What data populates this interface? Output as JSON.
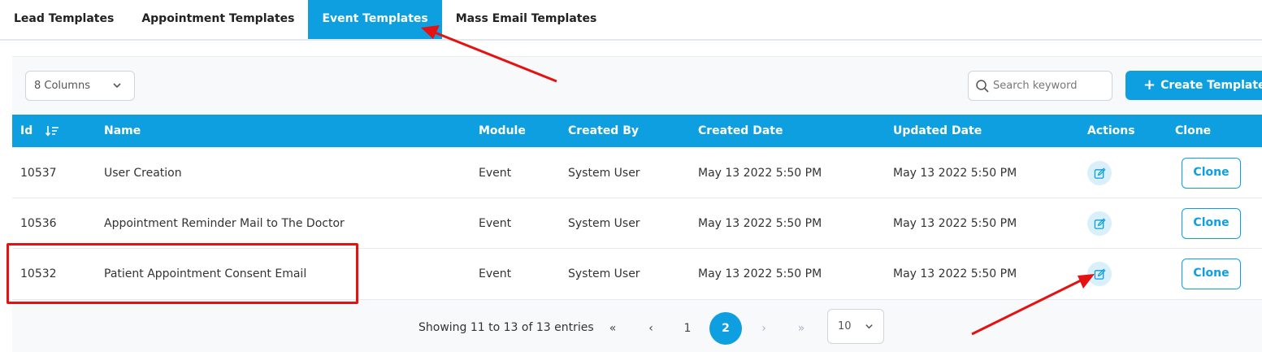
{
  "tabs": [
    {
      "label": "Lead Templates",
      "active": false
    },
    {
      "label": "Appointment Templates",
      "active": false
    },
    {
      "label": "Event Templates",
      "active": true
    },
    {
      "label": "Mass Email Templates",
      "active": false
    }
  ],
  "toolbar": {
    "columns_label": "8 Columns",
    "search_placeholder": "Search keyword",
    "search_value": "",
    "create_label": "Create Template"
  },
  "table": {
    "headers": {
      "id": "Id",
      "name": "Name",
      "module": "Module",
      "created_by": "Created By",
      "created_date": "Created Date",
      "updated_date": "Updated Date",
      "actions": "Actions",
      "clone": "Clone"
    },
    "rows": [
      {
        "id": "10537",
        "name": "User Creation",
        "module": "Event",
        "created_by": "System User",
        "created_date": "May 13 2022 5:50 PM",
        "updated_date": "May 13 2022 5:50 PM",
        "clone_label": "Clone"
      },
      {
        "id": "10536",
        "name": "Appointment Reminder Mail to The Doctor",
        "module": "Event",
        "created_by": "System User",
        "created_date": "May 13 2022 5:50 PM",
        "updated_date": "May 13 2022 5:50 PM",
        "clone_label": "Clone"
      },
      {
        "id": "10532",
        "name": "Patient Appointment Consent Email",
        "module": "Event",
        "created_by": "System User",
        "created_date": "May 13 2022 5:50 PM",
        "updated_date": "May 13 2022 5:50 PM",
        "clone_label": "Clone"
      }
    ]
  },
  "pagination": {
    "summary": "Showing 11 to 13 of 13 entries",
    "first": "«",
    "prev": "‹",
    "pages": [
      "1",
      "2"
    ],
    "current_page": "2",
    "next": "›",
    "last": "»",
    "page_size": "10"
  },
  "colors": {
    "accent": "#0d9fe0",
    "annotation": "#e41212"
  },
  "icons": {
    "sort": "sort-descending-icon",
    "search": "search-icon",
    "plus": "plus-icon",
    "edit": "edit-icon",
    "chevron": "chevron-down-icon"
  }
}
